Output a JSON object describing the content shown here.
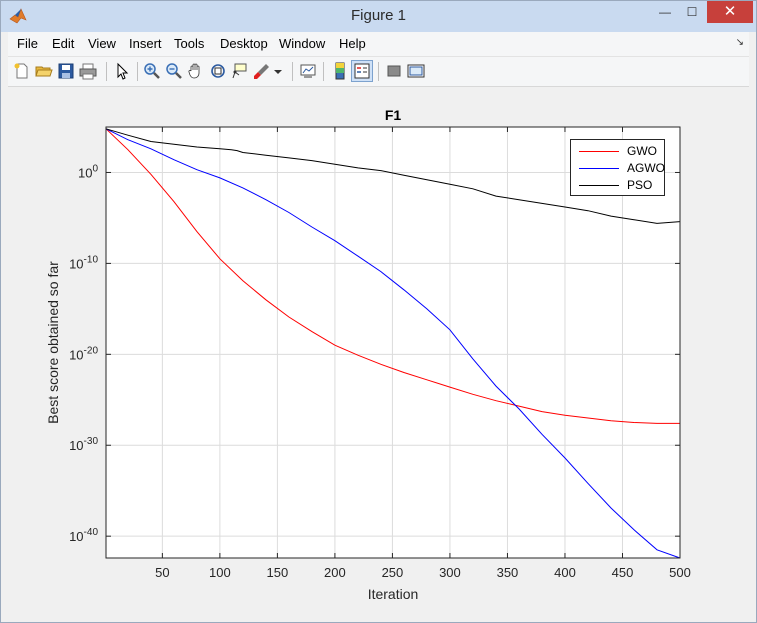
{
  "window": {
    "title": "Figure 1",
    "minimize_glyph": "—",
    "maximize_glyph": "☐",
    "close_glyph": "✕"
  },
  "menu": [
    "File",
    "Edit",
    "View",
    "Insert",
    "Tools",
    "Desktop",
    "Window",
    "Help"
  ],
  "menubar_arrow": "↘",
  "toolbar": {
    "icons": [
      "new-figure-icon",
      "open-file-icon",
      "save-icon",
      "print-icon",
      "pointer-icon",
      "zoom-in-icon",
      "zoom-out-icon",
      "pan-icon",
      "rotate-3d-icon",
      "data-cursor-icon",
      "brush-icon",
      "link-plot-icon",
      "insert-colorbar-icon",
      "insert-legend-icon",
      "hide-plot-tools-icon",
      "show-plot-tools-icon"
    ]
  },
  "colors": {
    "gwo": "#ff0000",
    "agwo": "#0000ff",
    "pso": "#000000",
    "grid": "#dcdcdc",
    "titlebar": "#c9daf0"
  },
  "chart_data": {
    "type": "line",
    "title": "F1",
    "xlabel": "Iteration",
    "ylabel": "Best score obtained so far",
    "xlim": [
      1,
      500
    ],
    "ylim_log10": [
      -42.4,
      5
    ],
    "yscale": "log",
    "xticks": [
      50,
      100,
      150,
      200,
      250,
      300,
      350,
      400,
      450,
      500
    ],
    "yticks": [
      {
        "exp": 0,
        "mant": "10",
        "sup": "0"
      },
      {
        "exp": -10,
        "mant": "10",
        "sup": "-10"
      },
      {
        "exp": -20,
        "mant": "10",
        "sup": "-20"
      },
      {
        "exp": -30,
        "mant": "10",
        "sup": "-30"
      },
      {
        "exp": -40,
        "mant": "10",
        "sup": "-40"
      }
    ],
    "grid": true,
    "legend_position": "top-right",
    "series": [
      {
        "name": "GWO",
        "color": "#ff0000",
        "x": [
          1,
          20,
          40,
          60,
          80,
          100,
          120,
          140,
          160,
          180,
          200,
          220,
          240,
          260,
          280,
          300,
          320,
          340,
          360,
          380,
          400,
          420,
          440,
          460,
          480,
          500
        ],
        "log10_y": [
          4.8,
          2.5,
          -0.2,
          -3.2,
          -6.5,
          -9.5,
          -11.9,
          -14.0,
          -15.9,
          -17.5,
          -19.0,
          -20.1,
          -21.1,
          -22.0,
          -22.8,
          -23.6,
          -24.4,
          -25.1,
          -25.7,
          -26.3,
          -26.7,
          -27.0,
          -27.3,
          -27.5,
          -27.6,
          -27.6
        ]
      },
      {
        "name": "AGWO",
        "color": "#0000ff",
        "x": [
          1,
          20,
          40,
          60,
          80,
          100,
          120,
          140,
          160,
          180,
          200,
          220,
          240,
          260,
          280,
          300,
          320,
          340,
          360,
          380,
          400,
          420,
          440,
          460,
          480,
          500
        ],
        "log10_y": [
          4.8,
          3.6,
          2.6,
          1.4,
          0.3,
          -0.6,
          -1.7,
          -3.0,
          -4.4,
          -6.0,
          -7.5,
          -9.2,
          -10.9,
          -12.9,
          -15.0,
          -17.3,
          -20.5,
          -23.5,
          -26.0,
          -28.8,
          -31.4,
          -34.2,
          -36.9,
          -39.3,
          -41.5,
          -42.4
        ]
      },
      {
        "name": "PSO",
        "color": "#000000",
        "x": [
          1,
          20,
          40,
          60,
          80,
          100,
          110,
          115,
          120,
          140,
          160,
          180,
          200,
          220,
          240,
          260,
          280,
          300,
          320,
          340,
          360,
          380,
          400,
          420,
          440,
          460,
          480,
          500
        ],
        "log10_y": [
          4.8,
          4.1,
          3.4,
          3.1,
          2.8,
          2.6,
          2.5,
          2.4,
          2.2,
          1.9,
          1.6,
          1.3,
          0.9,
          0.5,
          0.2,
          -0.3,
          -0.8,
          -1.3,
          -1.8,
          -2.6,
          -3.0,
          -3.4,
          -3.8,
          -4.2,
          -4.8,
          -5.2,
          -5.6,
          -5.4
        ]
      }
    ]
  }
}
